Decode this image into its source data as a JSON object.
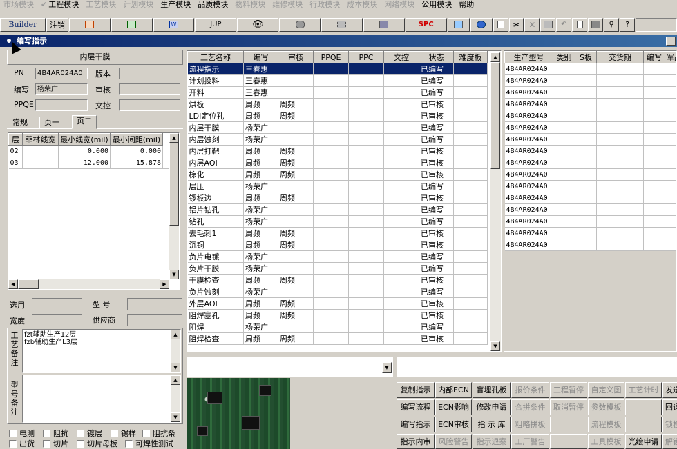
{
  "menu": [
    "市场模块",
    "工程模块",
    "工艺模块",
    "计划模块",
    "生产模块",
    "品质模块",
    "物料模块",
    "维修模块",
    "行政模块",
    "成本模块",
    "网络模块",
    "公用模块",
    "帮助"
  ],
  "toolbar": {
    "builder": "Builder",
    "logout": "注销",
    "jup": "JUP",
    "spc": "SPC"
  },
  "window_title": "编写指示",
  "left": {
    "header": "内层干膜",
    "pn_label": "PN",
    "pn_value": "4B4AR024A0",
    "version_label": "版本",
    "version_value": "",
    "author_label": "编写",
    "author_value": "杨荣广",
    "review_label": "审核",
    "review_value": "",
    "ppqe_label": "PPQE",
    "ppqe_value": "",
    "doccontrol_label": "文控",
    "doccontrol_value": "",
    "tabs": [
      "常规",
      "页一",
      "页二"
    ],
    "layer_table": {
      "headers": [
        "层",
        "菲林线宽",
        "最小线宽(mil)",
        "最小间距(mil)"
      ],
      "rows": [
        [
          "02",
          "",
          "0.000",
          "0.000"
        ],
        [
          "03",
          "",
          "12.000",
          "15.878"
        ]
      ]
    },
    "select_label": "选用",
    "model_label": "型  号",
    "width_label": "宽度",
    "supplier_label": "供应商",
    "remark_label": "工艺备注",
    "remark_lines": [
      "fzt辅助生产12层",
      "fzb辅助生产L3层"
    ],
    "model_remark_label": "型号备注",
    "checkboxes_row1": [
      "电测",
      "阻抗",
      "镀层",
      "锡样",
      "阻抗条"
    ],
    "checkboxes_row2": [
      "出货",
      "切片",
      "切片母板",
      "可焊性测试"
    ]
  },
  "process_table": {
    "headers": [
      "工艺名称",
      "编写",
      "审核",
      "PPQE",
      "PPC",
      "文控",
      "状态",
      "难度板"
    ],
    "rows": [
      [
        "流程指示",
        "王春惠",
        "",
        "",
        "",
        "",
        "已编写",
        ""
      ],
      [
        "计划投料",
        "王春惠",
        "",
        "",
        "",
        "",
        "已编写",
        ""
      ],
      [
        "开料",
        "王春惠",
        "",
        "",
        "",
        "",
        "已编写",
        ""
      ],
      [
        "烘板",
        "周频",
        "周频",
        "",
        "",
        "",
        "已审核",
        ""
      ],
      [
        "LDI定位孔",
        "周频",
        "周频",
        "",
        "",
        "",
        "已审核",
        ""
      ],
      [
        "内层干膜",
        "杨荣广",
        "",
        "",
        "",
        "",
        "已编写",
        ""
      ],
      [
        "内层蚀刻",
        "杨荣广",
        "",
        "",
        "",
        "",
        "已编写",
        ""
      ],
      [
        "内层打靶",
        "周频",
        "周频",
        "",
        "",
        "",
        "已审核",
        ""
      ],
      [
        "内层AOI",
        "周频",
        "周频",
        "",
        "",
        "",
        "已审核",
        ""
      ],
      [
        "棕化",
        "周频",
        "周频",
        "",
        "",
        "",
        "已审核",
        ""
      ],
      [
        "层压",
        "杨荣广",
        "",
        "",
        "",
        "",
        "已编写",
        ""
      ],
      [
        "锣板边",
        "周频",
        "周频",
        "",
        "",
        "",
        "已审核",
        ""
      ],
      [
        "铝片钻孔",
        "杨荣广",
        "",
        "",
        "",
        "",
        "已编写",
        ""
      ],
      [
        "钻孔",
        "杨荣广",
        "",
        "",
        "",
        "",
        "已编写",
        ""
      ],
      [
        "去毛刺1",
        "周频",
        "周频",
        "",
        "",
        "",
        "已审核",
        ""
      ],
      [
        "沉铜",
        "周频",
        "周频",
        "",
        "",
        "",
        "已审核",
        ""
      ],
      [
        "负片电镀",
        "杨荣广",
        "",
        "",
        "",
        "",
        "已编写",
        ""
      ],
      [
        "负片干膜",
        "杨荣广",
        "",
        "",
        "",
        "",
        "已编写",
        ""
      ],
      [
        "干膜检查",
        "周频",
        "周频",
        "",
        "",
        "",
        "已审核",
        ""
      ],
      [
        "负片蚀刻",
        "杨荣广",
        "",
        "",
        "",
        "",
        "已编写",
        ""
      ],
      [
        "外层AOI",
        "周频",
        "周频",
        "",
        "",
        "",
        "已审核",
        ""
      ],
      [
        "阻焊塞孔",
        "周频",
        "周频",
        "",
        "",
        "",
        "已审核",
        ""
      ],
      [
        "阻焊",
        "杨荣广",
        "",
        "",
        "",
        "",
        "已编写",
        ""
      ],
      [
        "阻焊检查",
        "周频",
        "周频",
        "",
        "",
        "",
        "已审核",
        ""
      ]
    ]
  },
  "product_table": {
    "headers": [
      "生产型号",
      "类别",
      "S板",
      "交货期",
      "编写",
      "军品"
    ],
    "rows": [
      "4B4AR024A0",
      "4B4AR024A0",
      "4B4AR024A0",
      "4B4AR024A0",
      "4B4AR024A0",
      "4B4AR024A0",
      "4B4AR024A0",
      "4B4AR024A0",
      "4B4AR024A0",
      "4B4AR024A0",
      "4B4AR024A0",
      "4B4AR024A0",
      "4B4AR024A0",
      "4B4AR024A0",
      "4B4AR024A0",
      "4B4AR024A0"
    ]
  },
  "buttons": [
    [
      {
        "t": "复制指示",
        "d": false
      },
      {
        "t": "内部ECN",
        "d": false
      },
      {
        "t": "盲埋孔板",
        "d": false
      },
      {
        "t": "报价条件",
        "d": true
      },
      {
        "t": "工程暂停",
        "d": true
      },
      {
        "t": "自定义图",
        "d": true
      },
      {
        "t": "工艺计时",
        "d": true
      },
      {
        "t": "发送",
        "d": false
      }
    ],
    [
      {
        "t": "编写流程",
        "d": false
      },
      {
        "t": "ECN影响",
        "d": false
      },
      {
        "t": "修改申请",
        "d": false
      },
      {
        "t": "合拼条件",
        "d": true
      },
      {
        "t": "取消暂停",
        "d": true
      },
      {
        "t": "参数模板",
        "d": true
      },
      {
        "t": "",
        "d": true
      },
      {
        "t": "回退",
        "d": false
      }
    ],
    [
      {
        "t": "编写指示",
        "d": false
      },
      {
        "t": "ECN审核",
        "d": false
      },
      {
        "t": "指 示 库",
        "d": false
      },
      {
        "t": "粗略拼板",
        "d": true
      },
      {
        "t": "",
        "d": true
      },
      {
        "t": "流程模板",
        "d": true
      },
      {
        "t": "",
        "d": true
      },
      {
        "t": "锁板",
        "d": true
      }
    ],
    [
      {
        "t": "指示内审",
        "d": false
      },
      {
        "t": "风险警告",
        "d": true
      },
      {
        "t": "指示退案",
        "d": true
      },
      {
        "t": "工厂警告",
        "d": true
      },
      {
        "t": "",
        "d": true
      },
      {
        "t": "工具模板",
        "d": true
      },
      {
        "t": "光绘申请",
        "d": false
      },
      {
        "t": "解锁",
        "d": true
      }
    ]
  ]
}
